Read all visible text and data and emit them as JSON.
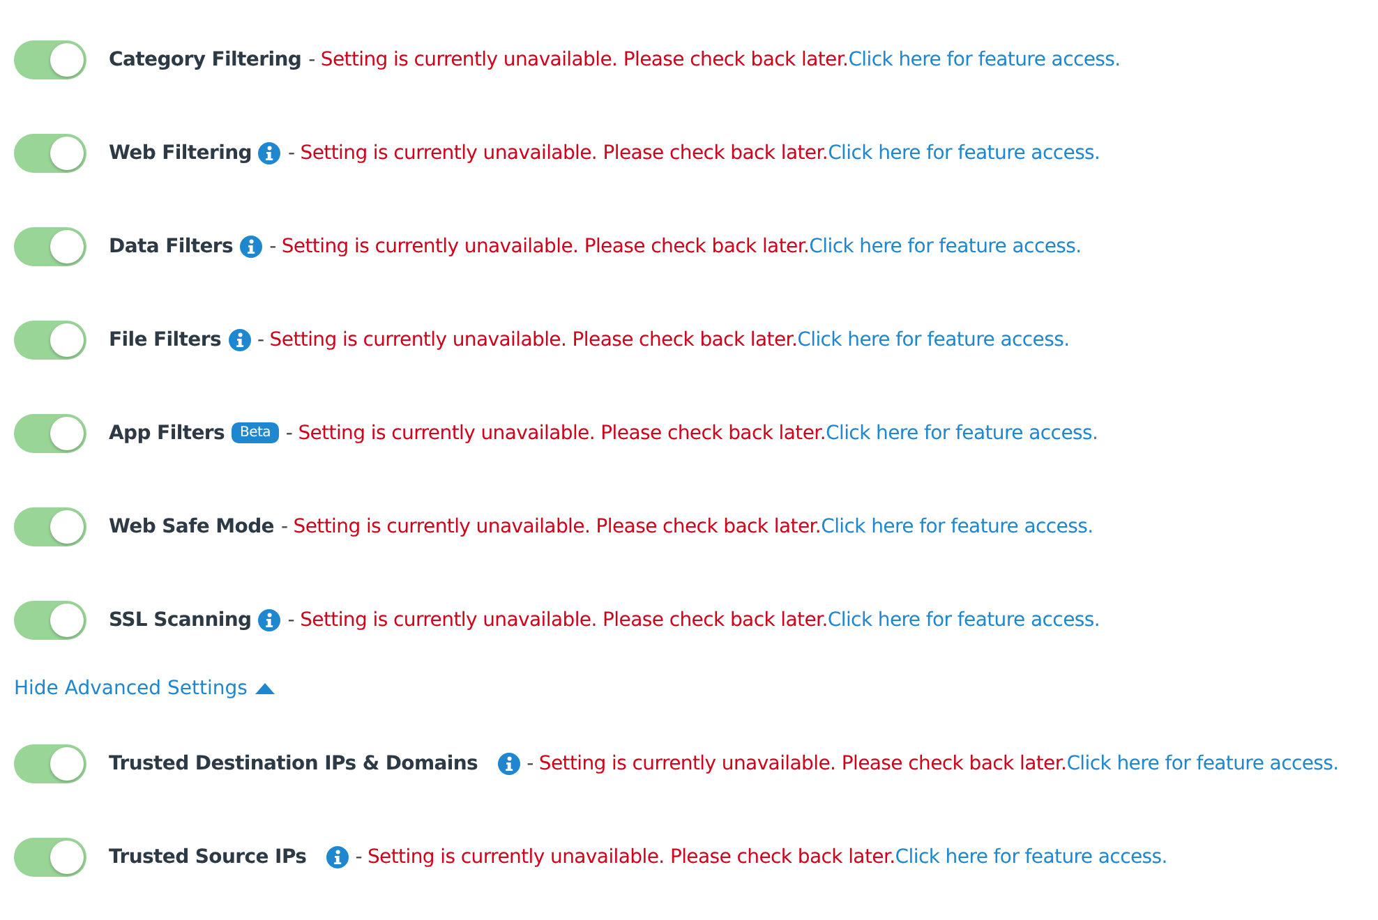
{
  "settings": [
    {
      "label": "Category Filtering",
      "on": true,
      "separator": "-",
      "message": "Setting is currently unavailable. Please check back later.",
      "link": "Click here for feature access."
    },
    {
      "label": "Web Filtering",
      "on": true,
      "marker": {
        "kind": "info"
      },
      "separator": "-",
      "message": "Setting is currently unavailable. Please check back later.",
      "link": "Click here for feature access."
    },
    {
      "label": "Data Filters",
      "on": true,
      "marker": {
        "kind": "info"
      },
      "separator": "-",
      "message": "Setting is currently unavailable. Please check back later.",
      "link": "Click here for feature access."
    },
    {
      "label": "File Filters",
      "on": true,
      "marker": {
        "kind": "info"
      },
      "separator": "-",
      "message": "Setting is currently unavailable. Please check back later.",
      "link": "Click here for feature access."
    },
    {
      "label": "App Filters",
      "on": true,
      "marker": {
        "kind": "badge",
        "text": "Beta"
      },
      "separator": "-",
      "message": "Setting is currently unavailable. Please check back later.",
      "link": "Click here for feature access."
    },
    {
      "label": "Web Safe Mode",
      "on": true,
      "separator": "-",
      "message": "Setting is currently unavailable. Please check back later.",
      "link": "Click here for feature access."
    },
    {
      "label": "SSL Scanning",
      "on": true,
      "marker": {
        "kind": "info"
      },
      "separator": "-",
      "message": "Setting is currently unavailable. Please check back later.",
      "link": "Click here for feature access."
    }
  ],
  "advanced_toggle": {
    "label": "Hide Advanced Settings",
    "expanded": true
  },
  "advanced_settings": [
    {
      "label": "Trusted Destination IPs & Domains",
      "on": true,
      "marker": {
        "kind": "info"
      },
      "separator": "-",
      "message": "Setting is currently unavailable. Please check back later.",
      "link": "Click here for feature access."
    },
    {
      "label": "Trusted Source IPs",
      "on": true,
      "marker": {
        "kind": "info"
      },
      "separator": "-",
      "message": "Setting is currently unavailable. Please check back later.",
      "link": "Click here for feature access."
    }
  ]
}
